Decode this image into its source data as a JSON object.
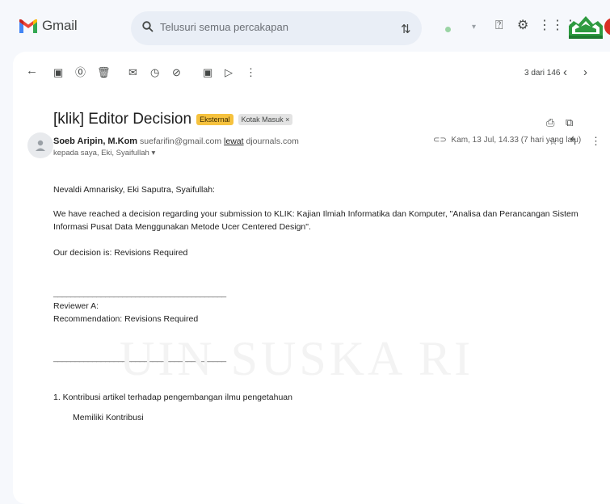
{
  "app": {
    "name": "Gmail"
  },
  "search": {
    "placeholder": "Telusuri semua percakapan"
  },
  "pager": {
    "text": "3 dari 146"
  },
  "email": {
    "subject": "[klik] Editor Decision",
    "labels": {
      "external": "Eksternal",
      "inbox": "Kotak Masuk ×"
    },
    "sender": {
      "name": "Soeb Aripin, M.Kom",
      "email": "suefarifin@gmail.com",
      "via_word": "lewat",
      "via_domain": "djournals.com"
    },
    "recipients": "kepada saya, Eki, Syaifullah ▾",
    "date": "Kam, 13 Jul, 14.33 (7 hari yang lalu)",
    "body": {
      "greeting": "Nevaldi Amnarisky, Eki Saputra, Syaifullah:",
      "intro": "We have reached a decision regarding your submission to KLIK: Kajian Ilmiah Informatika dan Komputer, \"Analisa dan Perancangan Sistem Informasi Pusat Data Menggunakan Metode Ucer Centered Design\".",
      "decision": "Our decision is: Revisions Required",
      "separator": "________________________________________",
      "reviewer": "Reviewer A:",
      "recommendation": "Recommendation: Revisions Required",
      "q1": "1. Kontribusi artikel terhadap pengembangan ilmu pengetahuan",
      "a1": "Memiliki Kontribusi"
    }
  },
  "watermark": "UIN SUSKA RI",
  "icons": {
    "filter": "tune-icon",
    "help": "help-icon",
    "settings": "gear-icon",
    "apps": "apps-grid-icon",
    "back": "arrow-back-icon",
    "archive": "archive-icon",
    "spam": "report-icon",
    "delete": "trash-icon",
    "unread": "mail-icon",
    "snooze": "clock-icon",
    "task": "add-task-icon",
    "move": "move-to-icon",
    "label": "label-icon",
    "more": "more-vert-icon",
    "prev": "chevron-left-icon",
    "next": "chevron-right-icon",
    "print": "print-icon",
    "popout": "open-in-new-icon",
    "star": "star-icon",
    "reply": "reply-icon"
  },
  "colors": {
    "accent_gmail_red": "#ea4335",
    "external_badge": "#f6c23e",
    "background": "#f6f8fc"
  }
}
